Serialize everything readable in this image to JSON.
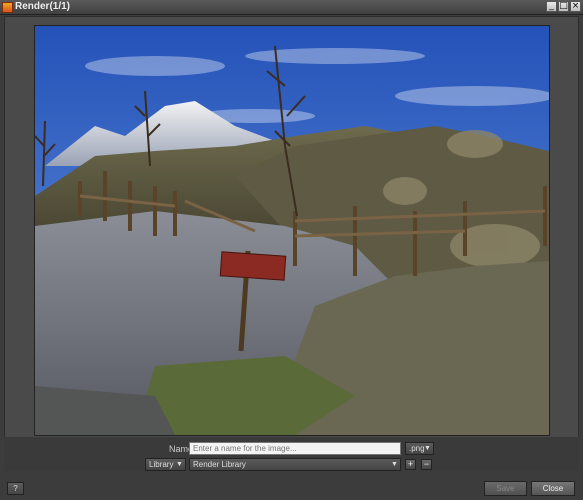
{
  "window": {
    "title": "Render(1/1)",
    "buttons": [
      "_",
      "□",
      "×"
    ]
  },
  "render_image": {
    "description_icon": "mountain-landscape-render"
  },
  "controls": {
    "name_label": "Name",
    "name_placeholder": "Enter a name for the image...",
    "format_value": ".png",
    "library_label": "Library",
    "library_value": "Render Library",
    "add_symbol": "+",
    "remove_symbol": "−"
  },
  "footer": {
    "help_label": "?",
    "save_label": "Save",
    "close_label": "Close"
  },
  "colors": {
    "titlebar": "#4a4a4a",
    "panel": "#4a4a4a",
    "input_bg": "#f4f4f4"
  }
}
